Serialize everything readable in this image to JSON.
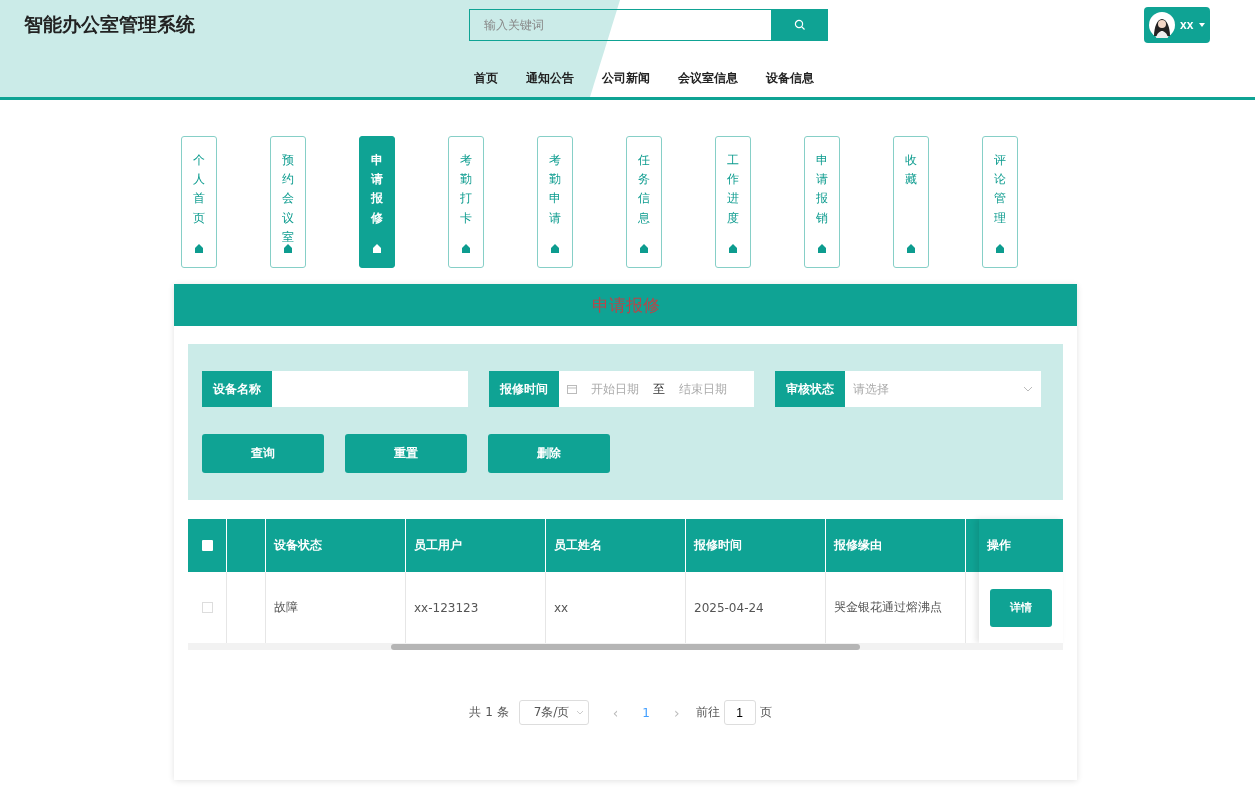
{
  "header": {
    "title": "智能办公室管理系统",
    "search": {
      "placeholder": "输入关键词"
    },
    "user": {
      "name": "xx"
    },
    "nav": [
      {
        "label": "首页"
      },
      {
        "label": "通知公告"
      },
      {
        "label": "公司新闻"
      },
      {
        "label": "会议室信息"
      },
      {
        "label": "设备信息"
      }
    ]
  },
  "side_menu": [
    {
      "label": "个人首页",
      "selected": false
    },
    {
      "label": "预约会议室",
      "selected": false
    },
    {
      "label": "申请报修",
      "selected": true
    },
    {
      "label": "考勤打卡",
      "selected": false
    },
    {
      "label": "考勤申请",
      "selected": false
    },
    {
      "label": "任务信息",
      "selected": false
    },
    {
      "label": "工作进度",
      "selected": false
    },
    {
      "label": "申请报销",
      "selected": false
    },
    {
      "label": "收藏",
      "selected": false
    },
    {
      "label": "评论管理",
      "selected": false
    }
  ],
  "panel": {
    "title": "申请报修",
    "filters": [
      {
        "kind": "text",
        "label": "设备名称"
      },
      {
        "kind": "daterange",
        "label": "报修时间",
        "start_placeholder": "开始日期",
        "separator": "至",
        "end_placeholder": "结束日期"
      },
      {
        "kind": "select",
        "label": "审核状态",
        "placeholder": "请选择"
      }
    ],
    "buttons": [
      "查询",
      "重置",
      "删除"
    ],
    "table": {
      "select_all_checked": false,
      "columns": [
        "设备状态",
        "员工用户",
        "员工姓名",
        "报修时间",
        "报修缘由"
      ],
      "action_column": "操作",
      "rows": [
        {
          "checked": false,
          "cells": [
            "故障",
            "xx-123123",
            "xx",
            "2025-04-24",
            "哭金银花通过熔沸点"
          ],
          "action": "详情"
        }
      ]
    },
    "pagination": {
      "total": "共 1 条",
      "page_size": "7条/页",
      "prev": "‹",
      "pages": [
        {
          "label": "1",
          "selected": true
        }
      ],
      "next": "›",
      "goto_label": "前往",
      "goto_value": "1",
      "goto_suffix": "页"
    }
  }
}
